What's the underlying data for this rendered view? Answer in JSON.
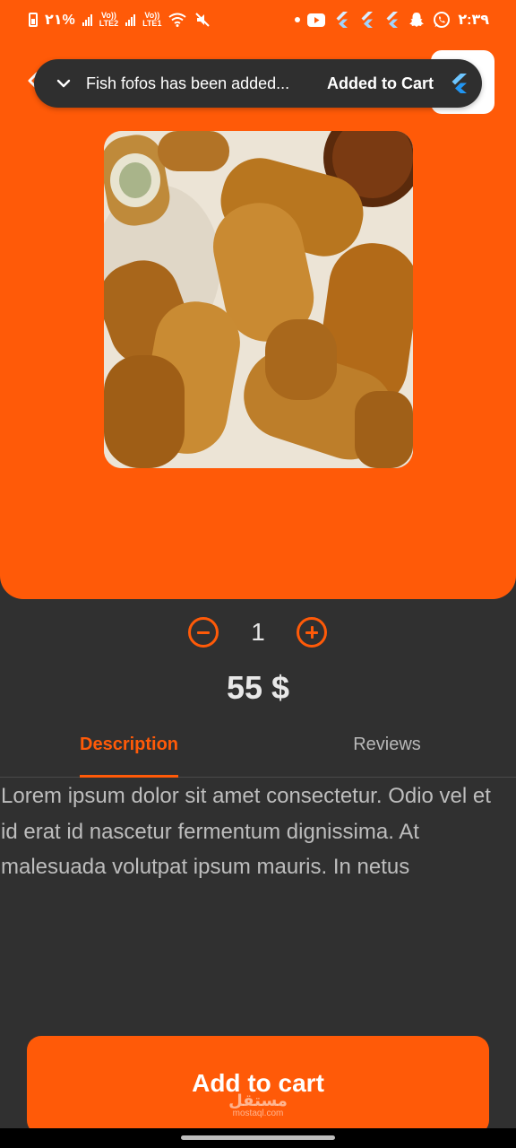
{
  "status_bar": {
    "battery_text": "٢١%",
    "network_1": "LTE2",
    "network_2": "LTE1",
    "volte": "Vo))",
    "time": "٢:٣٩",
    "icons": [
      "battery-icon",
      "signal-icon",
      "wifi-icon",
      "mute-icon",
      "youtube-icon",
      "flutter-icon",
      "snapchat-icon",
      "whatsapp-icon"
    ]
  },
  "snackbar": {
    "message": "Fish fofos has been added...",
    "action": "Added to Cart"
  },
  "product": {
    "quantity": "1",
    "price": "55 $"
  },
  "tabs": {
    "description": "Description",
    "reviews": "Reviews"
  },
  "description_text": "Lorem ipsum dolor sit amet consectetur. Odio vel et id erat id nascetur fermentum dignissima. At malesuada volutpat ipsum mauris. In netus",
  "add_to_cart": "Add to cart",
  "watermark": {
    "arabic": "مستقل",
    "domain": "mostaql.com"
  },
  "colors": {
    "accent": "#FF5A08",
    "background": "#303030",
    "snackbar": "#2f2f2f"
  }
}
